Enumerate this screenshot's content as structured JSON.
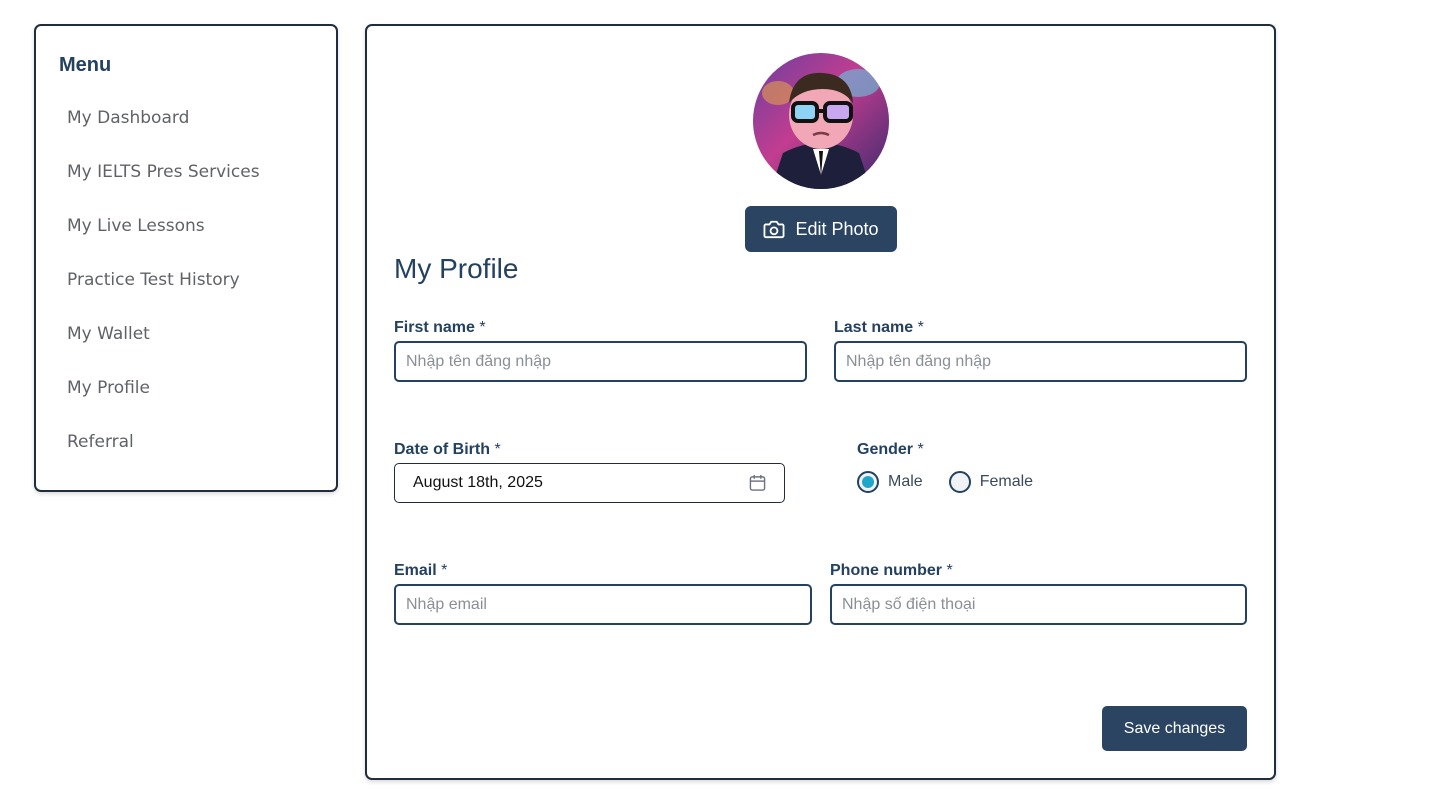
{
  "menu": {
    "title": "Menu",
    "items": [
      {
        "label": "My Dashboard"
      },
      {
        "label": "My IELTS Pres Services"
      },
      {
        "label": "My Live Lessons"
      },
      {
        "label": "Practice Test History"
      },
      {
        "label": "My Wallet"
      },
      {
        "label": "My Profile"
      },
      {
        "label": "Referral"
      }
    ]
  },
  "profile": {
    "edit_photo_label": "Edit Photo",
    "title": "My Profile",
    "first_name": {
      "label": "First name",
      "required_mark": "*",
      "value": "",
      "placeholder": "Nhập tên đăng nhập"
    },
    "last_name": {
      "label": "Last name",
      "required_mark": "*",
      "value": "",
      "placeholder": "Nhập tên đăng nhập"
    },
    "dob": {
      "label": "Date of Birth",
      "required_mark": "*",
      "value": "August 18th, 2025"
    },
    "gender": {
      "label": "Gender",
      "required_mark": "*",
      "options": [
        {
          "label": "Male",
          "selected": true
        },
        {
          "label": "Female",
          "selected": false
        }
      ]
    },
    "email": {
      "label": "Email",
      "required_mark": "*",
      "value": "",
      "placeholder": "Nhập email"
    },
    "phone": {
      "label": "Phone number",
      "required_mark": "*",
      "value": "",
      "placeholder": "Nhập số điện thoại"
    },
    "save_label": "Save changes"
  },
  "icons": {
    "edit_photo": "camera-icon",
    "date": "calendar-icon"
  },
  "colors": {
    "primary": "#2a4462",
    "text": "#24415f",
    "radio_selected": "#1fa7c7",
    "menu_text": "#5f6368"
  }
}
